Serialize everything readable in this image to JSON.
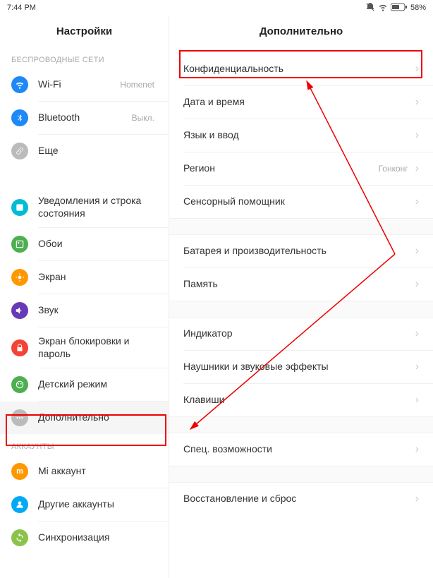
{
  "statusbar": {
    "time": "7:44 PM",
    "battery": "58%"
  },
  "left": {
    "title": "Настройки",
    "sections": {
      "wireless": "БЕСПРОВОДНЫЕ СЕТИ",
      "accounts": "АККАУНТЫ"
    },
    "items": {
      "wifi": {
        "label": "Wi-Fi",
        "value": "Homenet"
      },
      "bluetooth": {
        "label": "Bluetooth",
        "value": "Выкл."
      },
      "more": {
        "label": "Еще"
      },
      "notifications": {
        "label": "Уведомления и строка состояния"
      },
      "wallpaper": {
        "label": "Обои"
      },
      "display": {
        "label": "Экран"
      },
      "sound": {
        "label": "Звук"
      },
      "lockscreen": {
        "label": "Экран блокировки и пароль"
      },
      "childmode": {
        "label": "Детский режим"
      },
      "additional": {
        "label": "Дополнительно"
      },
      "miaccount": {
        "label": "Mi аккаунт"
      },
      "otheraccounts": {
        "label": "Другие аккаунты"
      },
      "sync": {
        "label": "Синхронизация"
      }
    }
  },
  "right": {
    "title": "Дополнительно",
    "items": {
      "privacy": {
        "label": "Конфиденциальность"
      },
      "datetime": {
        "label": "Дата и время"
      },
      "language": {
        "label": "Язык и ввод"
      },
      "region": {
        "label": "Регион",
        "value": "Гонконг"
      },
      "sensor": {
        "label": "Сенсорный помощник"
      },
      "battery": {
        "label": "Батарея и производительность"
      },
      "memory": {
        "label": "Память"
      },
      "indicator": {
        "label": "Индикатор"
      },
      "headphones": {
        "label": "Наушники и звуковые эффекты"
      },
      "keys": {
        "label": "Клавиши"
      },
      "accessibility": {
        "label": "Спец. возможности"
      },
      "reset": {
        "label": "Восстановление и сброс"
      }
    }
  }
}
